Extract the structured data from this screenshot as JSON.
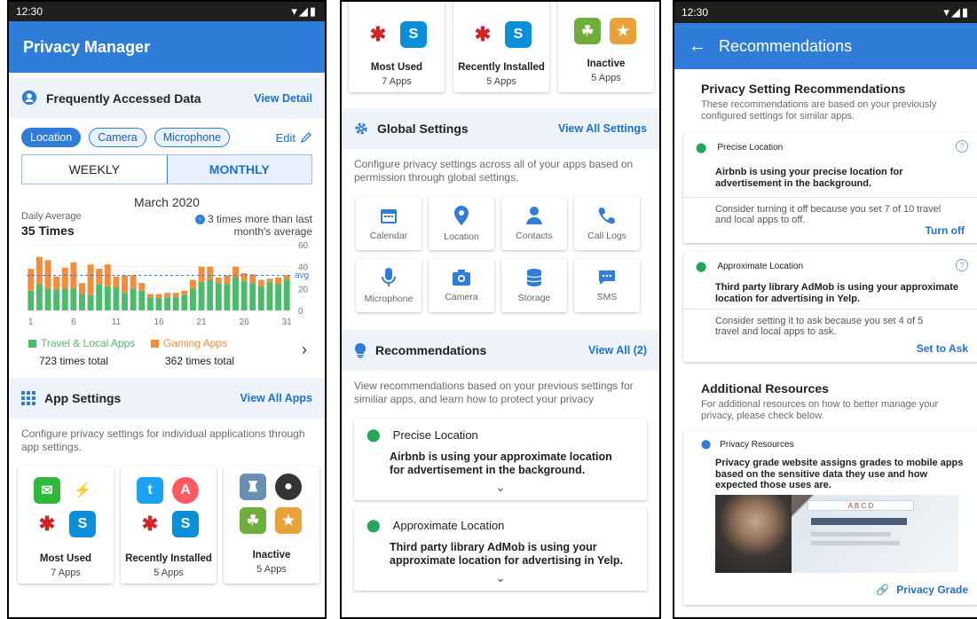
{
  "screen1": {
    "status_time": "12:30",
    "status_icons": "▾◢▮",
    "title": "Privacy Manager",
    "freq": {
      "heading": "Frequently Accessed Data",
      "view": "View Detail",
      "chips": [
        "Location",
        "Camera",
        "Microphone"
      ],
      "edit": "Edit",
      "weekly": "WEEKLY",
      "monthly": "MONTHLY",
      "month": "March 2020",
      "avg_label": "Daily Average",
      "avg_value": "35 Times",
      "note": "3 times more than last month's average",
      "legend1": "Travel & Local Apps",
      "legend2": "Gaming Apps",
      "total1": "723 times total",
      "total2": "362 times total"
    },
    "apps": {
      "heading": "App Settings",
      "view": "View All Apps",
      "desc": "Configure privacy settings for individual applications through app settings.",
      "cards": [
        {
          "title": "Most Used",
          "count": "7 Apps"
        },
        {
          "title": "Recently Installed",
          "count": "5 Apps"
        },
        {
          "title": "Inactive",
          "count": "5 Apps"
        }
      ]
    }
  },
  "chart_data": {
    "type": "bar",
    "categories": [
      "1",
      "2",
      "3",
      "4",
      "5",
      "6",
      "7",
      "8",
      "9",
      "10",
      "11",
      "12",
      "13",
      "14",
      "15",
      "16",
      "17",
      "18",
      "19",
      "20",
      "21",
      "22",
      "23",
      "24",
      "25",
      "26",
      "27",
      "28",
      "29",
      "30",
      "31"
    ],
    "x_tick_labels": [
      "1",
      "6",
      "11",
      "16",
      "21",
      "26",
      "31"
    ],
    "y_tick_labels": [
      "0",
      "20",
      "40",
      "60"
    ],
    "avg_marker": "avg",
    "ylim": [
      0,
      60
    ],
    "average": 32,
    "series": [
      {
        "name": "Travel & Local Apps",
        "color": "#4cbb6c",
        "values": [
          18,
          24,
          20,
          19,
          20,
          20,
          15,
          14,
          24,
          22,
          21,
          16,
          20,
          18,
          12,
          11,
          12,
          12,
          14,
          20,
          26,
          28,
          25,
          24,
          30,
          27,
          25,
          22,
          26,
          24,
          28
        ]
      },
      {
        "name": "Gaming Apps",
        "color": "#f58c3c",
        "values": [
          20,
          25,
          26,
          12,
          19,
          24,
          10,
          28,
          14,
          20,
          10,
          16,
          12,
          7,
          3,
          4,
          4,
          4,
          4,
          8,
          14,
          12,
          5,
          8,
          10,
          7,
          8,
          6,
          3,
          6,
          4
        ]
      }
    ]
  },
  "screen2": {
    "top_cards": [
      {
        "title": "Most Used",
        "count": "7 Apps"
      },
      {
        "title": "Recently Installed",
        "count": "5 Apps"
      },
      {
        "title": "Inactive",
        "count": "5 Apps"
      }
    ],
    "global": {
      "heading": "Global Settings",
      "view": "View All Settings",
      "desc": "Configure privacy settings across all of your apps based on permission through global settings.",
      "tiles": [
        "Calendar",
        "Location",
        "Contacts",
        "Call Logs",
        "Microphone",
        "Camera",
        "Storage",
        "SMS"
      ]
    },
    "recs": {
      "heading": "Recommendations",
      "view": "View All (2)",
      "desc": "View recommendations based on your previous settings for similiar apps, and learn how to protect your privacy",
      "items": [
        {
          "title": "Precise Location",
          "body": "Airbnb is using your approximate location for advertisement in the background."
        },
        {
          "title": "Approximate Location",
          "body": "Third party library AdMob is using your approximate location for advertising in Yelp."
        }
      ]
    }
  },
  "screen3": {
    "status_time": "12:30",
    "title": "Recommendations",
    "heading": "Privacy Setting Recommendations",
    "desc": "These recommendations are based on your previously configured settings for similar apps.",
    "items": [
      {
        "label": "Precise Location",
        "body": "Airbnb is using your precise location for advertisement in the background.",
        "advice": "Consider turning it off because you set 7 of 10 travel and local apps to off.",
        "action": "Turn off"
      },
      {
        "label": "Approximate Location",
        "body": "Third party library AdMob is using your approximate location for advertising in Yelp.",
        "advice": "Consider setting it to ask because you set 4 of 5 travel and local apps to ask.",
        "action": "Set to Ask"
      }
    ],
    "resources": {
      "heading": "Additional Resources",
      "desc": "For additional resources on how to better manage your privacy, please check below.",
      "card_label": "Privacy Resources",
      "card_body": "Privacy grade website assigns grades to mobile apps based on the sensitive data they use and how expected those uses are.",
      "grade_letters": "A B C D",
      "link": "Privacy Grade"
    }
  }
}
